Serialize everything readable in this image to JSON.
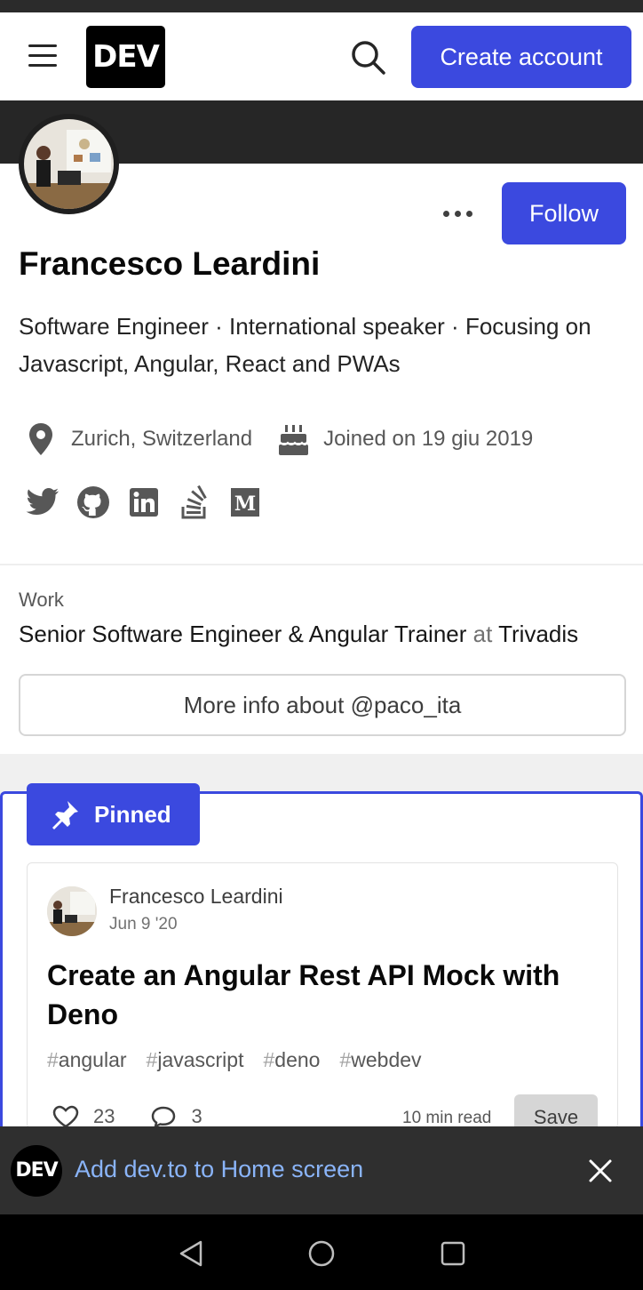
{
  "header": {
    "logo_text": "DEV",
    "create_account_label": "Create account",
    "menu_icon": "hamburger-icon",
    "search_icon": "search-icon"
  },
  "profile": {
    "name": "Francesco Leardini",
    "bio": "Software Engineer · International speaker · Focusing on Javascript, Angular, React and PWAs",
    "follow_label": "Follow",
    "location": "Zurich, Switzerland",
    "joined": "Joined on 19 giu 2019",
    "socials": [
      "twitter-icon",
      "github-icon",
      "linkedin-icon",
      "stackoverflow-icon",
      "medium-icon"
    ],
    "work_label": "Work",
    "work_title": "Senior Software Engineer & Angular Trainer",
    "work_at": "at",
    "work_company": "Trivadis",
    "more_info_label": "More info about @paco_ita"
  },
  "pinned": {
    "badge_label": "Pinned",
    "post": {
      "author": "Francesco Leardini",
      "date": "Jun 9 '20",
      "title": "Create an Angular Rest API Mock with Deno",
      "tags": [
        "angular",
        "javascript",
        "deno",
        "webdev"
      ],
      "reactions": "23",
      "comments": "3",
      "read_time": "10 min read",
      "save_label": "Save"
    }
  },
  "add_to_home": {
    "logo_text": "DEV",
    "text": "Add dev.to to Home screen"
  },
  "colors": {
    "accent": "#3b49df",
    "link": "#8ab4f8"
  }
}
